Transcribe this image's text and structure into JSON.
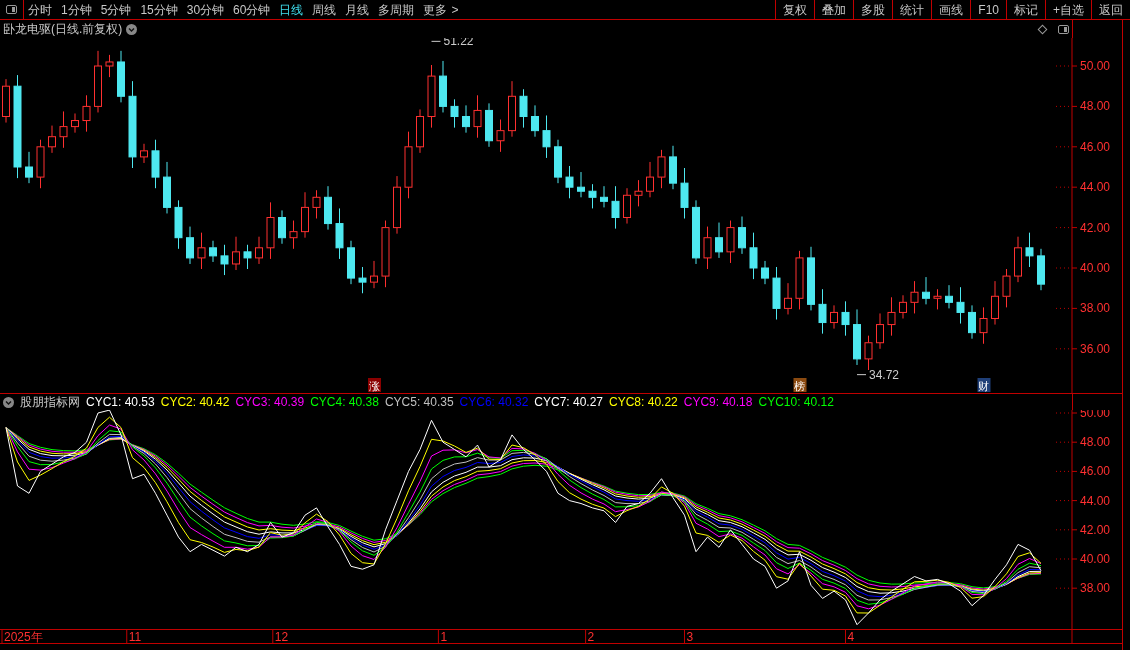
{
  "toolbar": {
    "periods": [
      {
        "label": "分时",
        "selected": false
      },
      {
        "label": "1分钟",
        "selected": false
      },
      {
        "label": "5分钟",
        "selected": false
      },
      {
        "label": "15分钟",
        "selected": false
      },
      {
        "label": "30分钟",
        "selected": false
      },
      {
        "label": "60分钟",
        "selected": false
      },
      {
        "label": "日线",
        "selected": true
      },
      {
        "label": "周线",
        "selected": false
      },
      {
        "label": "月线",
        "selected": false
      },
      {
        "label": "多周期",
        "selected": false
      },
      {
        "label": "更多",
        "selected": false
      }
    ],
    "more_chevron": ">",
    "buttons": [
      "复权",
      "叠加",
      "多股",
      "统计",
      "画线",
      "F10",
      "标记",
      "+自选",
      "返回"
    ]
  },
  "price_panel": {
    "title": "卧龙电驱(日线.前复权)",
    "y_axis": [
      "50.00",
      "48.00",
      "46.00",
      "44.00",
      "42.00",
      "40.00",
      "38.00",
      "36.00"
    ],
    "price_labels": [
      "51.22",
      "34.72"
    ],
    "markers": [
      {
        "label": "涨",
        "color": "#8b0000"
      },
      {
        "label": "榜",
        "color": "#8b4a10"
      },
      {
        "label": "财",
        "color": "#1f3f78"
      }
    ]
  },
  "indicator_panel": {
    "title": "股朋指标网",
    "legend": [
      {
        "label": "CYC1: 40.53",
        "color": "#ffffff"
      },
      {
        "label": "CYC2: 40.42",
        "color": "#ffff00"
      },
      {
        "label": "CYC3: 40.39",
        "color": "#ff00ff"
      },
      {
        "label": "CYC4: 40.38",
        "color": "#00ff00"
      },
      {
        "label": "CYC5: 40.35",
        "color": "#c0c0c0"
      },
      {
        "label": "CYC6: 40.32",
        "color": "#0000ff"
      },
      {
        "label": "CYC7: 40.27",
        "color": "#ffffff"
      },
      {
        "label": "CYC8: 40.22",
        "color": "#ffff00"
      },
      {
        "label": "CYC9: 40.18",
        "color": "#ff00ff"
      },
      {
        "label": "CYC10: 40.12",
        "color": "#00ff00"
      }
    ],
    "y_axis": [
      "50.00",
      "48.00",
      "46.00",
      "44.00",
      "42.00",
      "40.00",
      "38.00"
    ]
  },
  "x_axis": [
    "2025年",
    "11",
    "12",
    "1",
    "2",
    "3",
    "4"
  ]
}
